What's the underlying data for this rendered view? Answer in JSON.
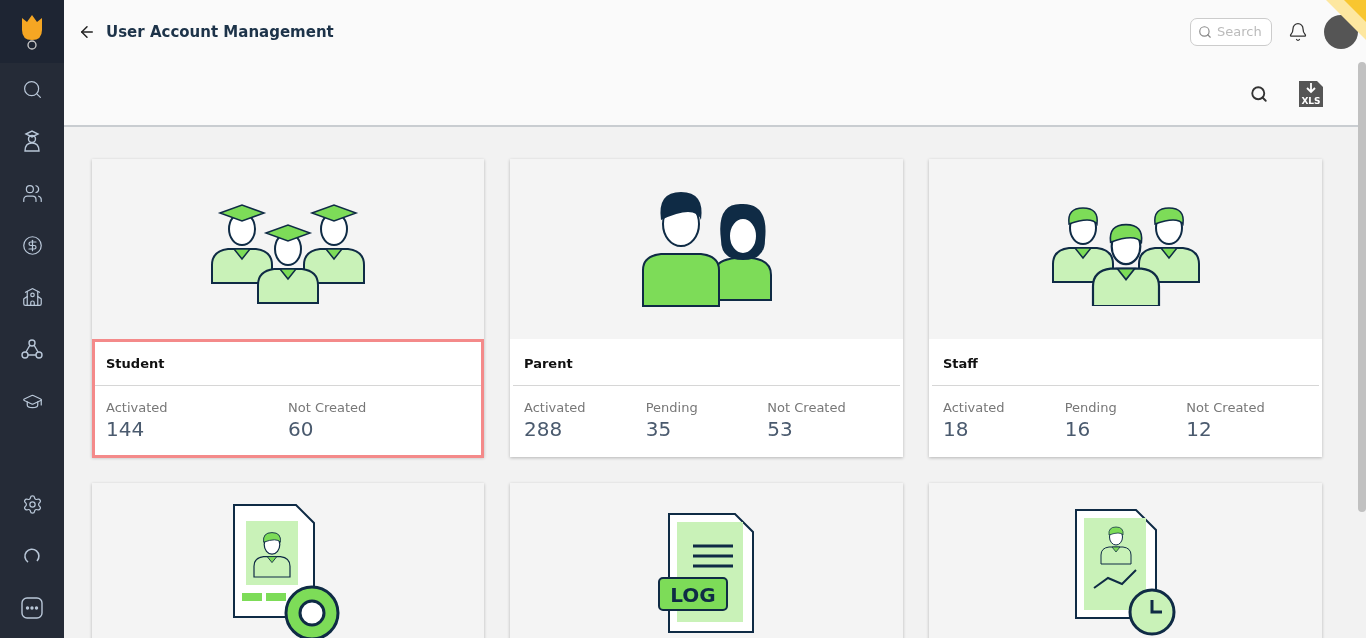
{
  "header": {
    "title": "User Account Management",
    "search": {
      "placeholder": "Search"
    }
  },
  "toolbar": {
    "export_label": "XLS"
  },
  "cards": [
    {
      "kind": "students",
      "title": "Student",
      "highlighted": true,
      "stats": [
        {
          "label": "Activated",
          "value": "144"
        },
        {
          "label": "Not Created",
          "value": "60"
        }
      ]
    },
    {
      "kind": "parents",
      "title": "Parent",
      "highlighted": false,
      "stats": [
        {
          "label": "Activated",
          "value": "288"
        },
        {
          "label": "Pending",
          "value": "35"
        },
        {
          "label": "Not Created",
          "value": "53"
        }
      ]
    },
    {
      "kind": "staff",
      "title": "Staff",
      "highlighted": false,
      "stats": [
        {
          "label": "Activated",
          "value": "18"
        },
        {
          "label": "Pending",
          "value": "16"
        },
        {
          "label": "Not Created",
          "value": "12"
        }
      ]
    },
    {
      "kind": "profile"
    },
    {
      "kind": "log",
      "drawing_text": "LOG"
    },
    {
      "kind": "report"
    }
  ]
}
